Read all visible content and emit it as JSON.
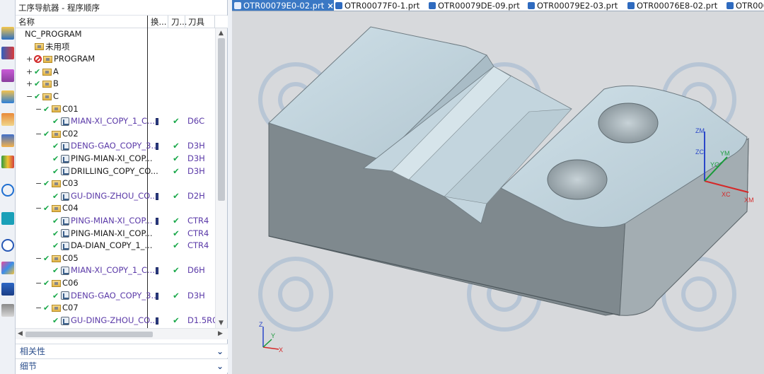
{
  "navigator": {
    "title": "工序导航器 - 程序顺序",
    "columns": {
      "name": "名称",
      "change": "换...",
      "tool_short": "刀...",
      "tool": "刀具"
    },
    "rows": [
      {
        "level": 0,
        "exp": "",
        "kind": "root",
        "label": "NC_PROGRAM",
        "purple": false,
        "change": false,
        "tool2": "",
        "tool": ""
      },
      {
        "level": 1,
        "exp": "",
        "kind": "folder",
        "label": "未用项",
        "purple": false,
        "change": false,
        "tool2": "",
        "tool": ""
      },
      {
        "level": 1,
        "exp": "+",
        "kind": "stopfolder",
        "label": "PROGRAM",
        "purple": false,
        "change": false,
        "tool2": "",
        "tool": ""
      },
      {
        "level": 1,
        "exp": "+",
        "kind": "chkfolder",
        "label": "A",
        "purple": false,
        "change": false,
        "tool2": "",
        "tool": ""
      },
      {
        "level": 1,
        "exp": "+",
        "kind": "chkfolder",
        "label": "B",
        "purple": false,
        "change": false,
        "tool2": "",
        "tool": ""
      },
      {
        "level": 1,
        "exp": "−",
        "kind": "chkfolder",
        "label": "C",
        "purple": false,
        "change": false,
        "tool2": "",
        "tool": ""
      },
      {
        "level": 2,
        "exp": "−",
        "kind": "chkfolder",
        "label": "C01",
        "purple": false,
        "change": false,
        "tool2": "",
        "tool": ""
      },
      {
        "level": 3,
        "exp": "",
        "kind": "op",
        "label": "MIAN-XI_COPY_1_C...",
        "purple": true,
        "change": true,
        "tool2": "✔",
        "tool": "D6C"
      },
      {
        "level": 2,
        "exp": "−",
        "kind": "chkfolder",
        "label": "C02",
        "purple": false,
        "change": false,
        "tool2": "",
        "tool": ""
      },
      {
        "level": 3,
        "exp": "",
        "kind": "op",
        "label": "DENG-GAO_COPY_3...",
        "purple": true,
        "change": true,
        "tool2": "✔",
        "tool": "D3H"
      },
      {
        "level": 3,
        "exp": "",
        "kind": "op",
        "label": "PING-MIAN-XI_COP...",
        "purple": false,
        "change": false,
        "tool2": "✔",
        "tool": "D3H"
      },
      {
        "level": 3,
        "exp": "",
        "kind": "op",
        "label": "DRILLING_COPY_CO...",
        "purple": false,
        "change": false,
        "tool2": "✔",
        "tool": "D3H"
      },
      {
        "level": 2,
        "exp": "−",
        "kind": "chkfolder",
        "label": "C03",
        "purple": false,
        "change": false,
        "tool2": "",
        "tool": ""
      },
      {
        "level": 3,
        "exp": "",
        "kind": "op",
        "label": "GU-DING-ZHOU_CO...",
        "purple": true,
        "change": true,
        "tool2": "✔",
        "tool": "D2H"
      },
      {
        "level": 2,
        "exp": "−",
        "kind": "chkfolder",
        "label": "C04",
        "purple": false,
        "change": false,
        "tool2": "",
        "tool": ""
      },
      {
        "level": 3,
        "exp": "",
        "kind": "op",
        "label": "PING-MIAN-XI_COP...",
        "purple": true,
        "change": true,
        "tool2": "✔",
        "tool": "CTR4"
      },
      {
        "level": 3,
        "exp": "",
        "kind": "op",
        "label": "PING-MIAN-XI_COP...",
        "purple": false,
        "change": false,
        "tool2": "✔",
        "tool": "CTR4"
      },
      {
        "level": 3,
        "exp": "",
        "kind": "op",
        "label": "DA-DIAN_COPY_1_...",
        "purple": false,
        "change": false,
        "tool2": "✔",
        "tool": "CTR4"
      },
      {
        "level": 2,
        "exp": "−",
        "kind": "chkfolder",
        "label": "C05",
        "purple": false,
        "change": false,
        "tool2": "",
        "tool": ""
      },
      {
        "level": 3,
        "exp": "",
        "kind": "op",
        "label": "MIAN-XI_COPY_1_C...",
        "purple": true,
        "change": true,
        "tool2": "✔",
        "tool": "D6H"
      },
      {
        "level": 2,
        "exp": "−",
        "kind": "chkfolder",
        "label": "C06",
        "purple": false,
        "change": false,
        "tool2": "",
        "tool": ""
      },
      {
        "level": 3,
        "exp": "",
        "kind": "op",
        "label": "DENG-GAO_COPY_3...",
        "purple": true,
        "change": true,
        "tool2": "✔",
        "tool": "D3H"
      },
      {
        "level": 2,
        "exp": "−",
        "kind": "chkfolder",
        "label": "C07",
        "purple": false,
        "change": false,
        "tool2": "",
        "tool": ""
      },
      {
        "level": 3,
        "exp": "",
        "kind": "op",
        "label": "GU-DING-ZHOU_CO...",
        "purple": true,
        "change": true,
        "tool2": "✔",
        "tool": "D1.5R0"
      }
    ],
    "sections": {
      "related": "相关性",
      "details": "细节"
    }
  },
  "tabs": [
    {
      "label": "OTR00079E0-02.prt",
      "active": true,
      "closable": true
    },
    {
      "label": "OTR00077F0-1.prt",
      "active": false,
      "closable": false
    },
    {
      "label": "OTR00079DE-09.prt",
      "active": false,
      "closable": false
    },
    {
      "label": "OTR00079E2-03.prt",
      "active": false,
      "closable": false
    },
    {
      "label": "OTR00076E8-02.prt",
      "active": false,
      "closable": false
    },
    {
      "label": "OTR000",
      "active": false,
      "closable": false
    }
  ],
  "viewport": {
    "csys_labels": {
      "zm": "ZM",
      "zc": "ZC",
      "ym": "YM",
      "yc": "YC",
      "xc": "XC",
      "xm": "XM"
    },
    "triad_labels": {
      "z": "Z",
      "y": "Y",
      "x": "X"
    }
  },
  "colors": {
    "accent": "#3a78c4",
    "check": "#1aa84a",
    "op_text": "#5b3aa8",
    "part_top": "#bfd3dd",
    "part_side": "#8c979d"
  }
}
